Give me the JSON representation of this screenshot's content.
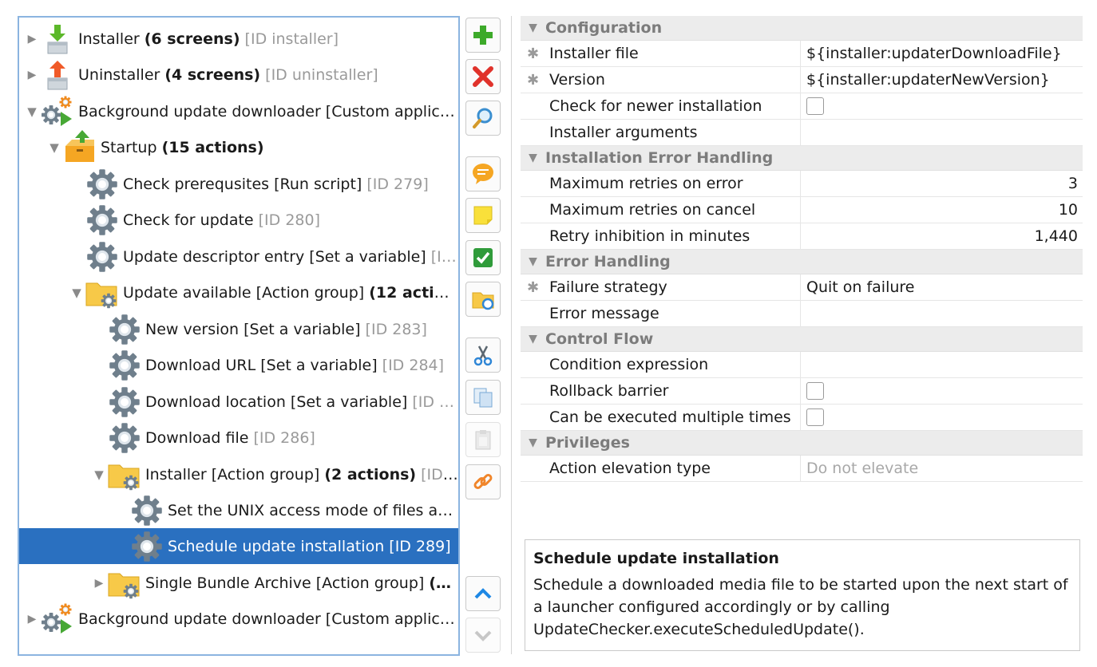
{
  "tree": {
    "items": [
      {
        "indent": 0,
        "twisty": "closed",
        "icon": "installer-icon",
        "label": "Installer ",
        "bold": "(6 screens)",
        "id": " [ID installer]",
        "selected": false
      },
      {
        "indent": 0,
        "twisty": "closed",
        "icon": "uninstaller-icon",
        "label": "Uninstaller ",
        "bold": "(4 screens)",
        "id": " [ID uninstaller]",
        "selected": false
      },
      {
        "indent": 0,
        "twisty": "open",
        "icon": "custom-application-icon",
        "label": "Background update downloader [Custom applic…",
        "bold": "",
        "id": "",
        "selected": false
      },
      {
        "indent": 1,
        "twisty": "open",
        "icon": "startup-icon",
        "label": "Startup ",
        "bold": "(15 actions)",
        "id": "",
        "selected": false
      },
      {
        "indent": 2,
        "twisty": "none",
        "icon": "gear-icon",
        "label": "Check prerequsites [Run script]",
        "bold": "",
        "id": " [ID 279]",
        "selected": false
      },
      {
        "indent": 2,
        "twisty": "none",
        "icon": "gear-icon",
        "label": "Check for update",
        "bold": "",
        "id": " [ID 280]",
        "selected": false
      },
      {
        "indent": 2,
        "twisty": "none",
        "icon": "gear-icon",
        "label": "Update descriptor entry [Set a variable]",
        "bold": "",
        "id": " [I…",
        "selected": false
      },
      {
        "indent": 2,
        "twisty": "open",
        "icon": "action-group-icon",
        "label": "Update available [Action group] ",
        "bold": "(12 actio…",
        "id": "",
        "selected": false
      },
      {
        "indent": 3,
        "twisty": "none",
        "icon": "gear-icon",
        "label": "New version [Set a variable]",
        "bold": "",
        "id": " [ID 283]",
        "selected": false
      },
      {
        "indent": 3,
        "twisty": "none",
        "icon": "gear-icon",
        "label": "Download URL [Set a variable]",
        "bold": "",
        "id": " [ID 284]",
        "selected": false
      },
      {
        "indent": 3,
        "twisty": "none",
        "icon": "gear-icon",
        "label": "Download location [Set a variable]",
        "bold": "",
        "id": " [ID …",
        "selected": false
      },
      {
        "indent": 3,
        "twisty": "none",
        "icon": "gear-icon",
        "label": "Download file",
        "bold": "",
        "id": " [ID 286]",
        "selected": false
      },
      {
        "indent": 3,
        "twisty": "open",
        "icon": "action-group-icon",
        "label": "Installer [Action group] ",
        "bold": "(2 actions)",
        "id": " [ID …",
        "selected": false
      },
      {
        "indent": 4,
        "twisty": "none",
        "icon": "gear-icon",
        "label": "Set the UNIX access mode of files an…",
        "bold": "",
        "id": "",
        "selected": false
      },
      {
        "indent": 4,
        "twisty": "none",
        "icon": "gear-icon",
        "label": "Schedule update installation [ID 289]",
        "bold": "",
        "id": "",
        "selected": true
      },
      {
        "indent": 3,
        "twisty": "closed",
        "icon": "action-group-icon",
        "label": "Single Bundle Archive [Action group] ",
        "bold": "(…",
        "id": "",
        "selected": false
      },
      {
        "indent": 0,
        "twisty": "closed",
        "icon": "custom-application-icon",
        "label": "Background update downloader [Custom applic…",
        "bold": "",
        "id": "",
        "selected": false
      }
    ]
  },
  "toolbar": [
    {
      "name": "add-button",
      "icon": "plus-icon",
      "enabled": true
    },
    {
      "name": "delete-button",
      "icon": "delete-x-icon",
      "enabled": true
    },
    {
      "name": "search-button",
      "icon": "magnifier-icon",
      "enabled": true
    },
    {
      "name": "comment-button",
      "icon": "comment-icon",
      "enabled": true
    },
    {
      "name": "note-button",
      "icon": "sticky-note-icon",
      "enabled": true
    },
    {
      "name": "check-button",
      "icon": "checkmark-icon",
      "enabled": true
    },
    {
      "name": "folder-link-button",
      "icon": "folder-link-icon",
      "enabled": true
    },
    {
      "name": "cut-button",
      "icon": "scissors-icon",
      "enabled": true
    },
    {
      "name": "copy-button",
      "icon": "copy-icon",
      "enabled": true
    },
    {
      "name": "paste-button",
      "icon": "paste-icon",
      "enabled": false
    },
    {
      "name": "link-button",
      "icon": "chain-link-icon",
      "enabled": true
    },
    {
      "name": "move-up-button",
      "icon": "chevron-up-icon",
      "enabled": true
    },
    {
      "name": "move-down-button",
      "icon": "chevron-down-icon",
      "enabled": false
    }
  ],
  "properties": {
    "sections": [
      {
        "title": "Configuration",
        "rows": [
          {
            "required": true,
            "name": "Installer file",
            "type": "text",
            "value": "${installer:updaterDownloadFile}"
          },
          {
            "required": true,
            "name": "Version",
            "type": "text",
            "value": "${installer:updaterNewVersion}"
          },
          {
            "required": false,
            "name": "Check for newer installation",
            "type": "checkbox",
            "value": ""
          },
          {
            "required": false,
            "name": "Installer arguments",
            "type": "text",
            "value": ""
          }
        ]
      },
      {
        "title": "Installation Error Handling",
        "rows": [
          {
            "required": false,
            "name": "Maximum retries on error",
            "type": "number",
            "value": "3"
          },
          {
            "required": false,
            "name": "Maximum retries on cancel",
            "type": "number",
            "value": "10"
          },
          {
            "required": false,
            "name": "Retry inhibition in minutes",
            "type": "number",
            "value": "1,440"
          }
        ]
      },
      {
        "title": "Error Handling",
        "rows": [
          {
            "required": true,
            "name": "Failure strategy",
            "type": "text",
            "value": "Quit on failure"
          },
          {
            "required": false,
            "name": "Error message",
            "type": "text",
            "value": ""
          }
        ]
      },
      {
        "title": "Control Flow",
        "rows": [
          {
            "required": false,
            "name": "Condition expression",
            "type": "text",
            "value": ""
          },
          {
            "required": false,
            "name": "Rollback barrier",
            "type": "checkbox",
            "value": ""
          },
          {
            "required": false,
            "name": "Can be executed multiple times",
            "type": "checkbox",
            "value": ""
          }
        ]
      },
      {
        "title": "Privileges",
        "rows": [
          {
            "required": false,
            "name": "Action elevation type",
            "type": "muted",
            "value": "Do not elevate"
          }
        ]
      }
    ]
  },
  "help": {
    "title": "Schedule update installation",
    "description": "Schedule a downloaded media file to be started upon the next start of a launcher configured accordingly or by calling UpdateChecker.executeScheduledUpdate()."
  },
  "colors": {
    "selection": "#2a70c0",
    "border": "#8bb4e0"
  }
}
